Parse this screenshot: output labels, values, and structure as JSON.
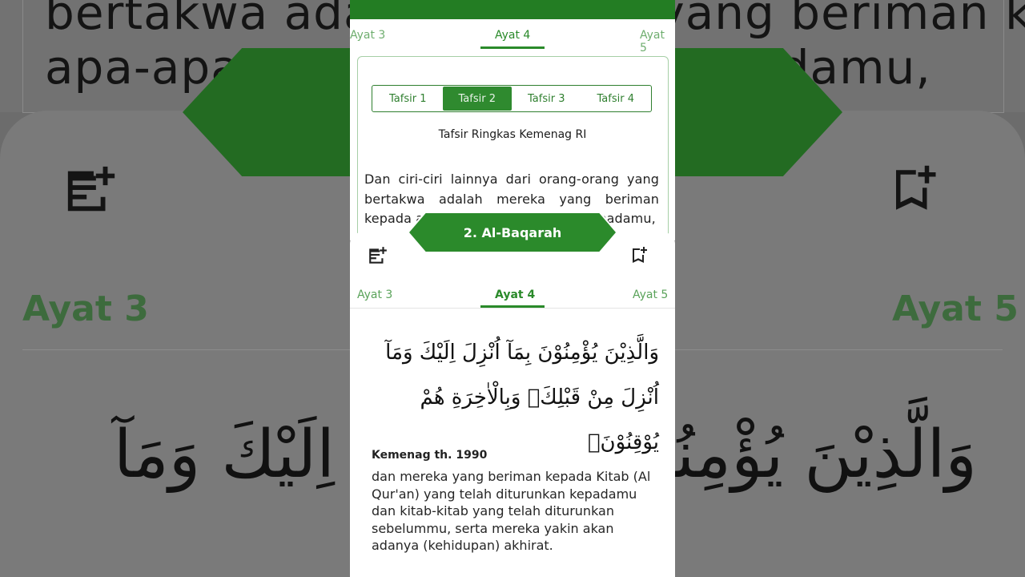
{
  "surah": {
    "title": "2. Al-Baqarah"
  },
  "tabs": {
    "prev": "Ayat 3",
    "current": "Ayat 4",
    "next": "Ayat 5"
  },
  "tafsir": {
    "options": [
      "Tafsir 1",
      "Tafsir 2",
      "Tafsir 3",
      "Tafsir 4"
    ],
    "selected": "Tafsir 2",
    "title": "Tafsir Ringkas Kemenag RI",
    "body": "Dan ciri-ciri lainnya dari orang-orang yang bertakwa adalah mereka yang beriman kepada apa-apa yang diturunkan kepadamu,"
  },
  "background": {
    "line1": "bertakwa adalah mereka yang beriman kepada",
    "line2": "apa-apa yang diturunkan kepadamu,",
    "arabic": "وَالَّذِيْنَ يُؤْمِنُوْنَ بِمَآ اُنْزِلَ اِلَيْكَ وَمَآ"
  },
  "verse": {
    "arabic_line1": "وَالَّذِيْنَ يُؤْمِنُوْنَ بِمَآ اُنْزِلَ اِلَيْكَ وَمَآ",
    "arabic_line2": "اُنْزِلَ مِنْ قَبْلِكَۚ وَبِالْاٰخِرَةِ هُمْ يُوْقِنُوْنَۗ",
    "source": "Kemenag th. 1990",
    "translation": "dan mereka yang beriman kepada Kitab (Al Qur'an) yang telah diturunkan kepadamu dan kitab-kitab yang telah diturunkan sebelummu, serta mereka yakin akan adanya (kehidupan) akhirat."
  },
  "icons": {
    "note": "note-add-icon",
    "bookmark": "bookmark-add-icon"
  },
  "colors": {
    "primary": "#2b8a2b",
    "accent_light": "#5aa35a"
  }
}
